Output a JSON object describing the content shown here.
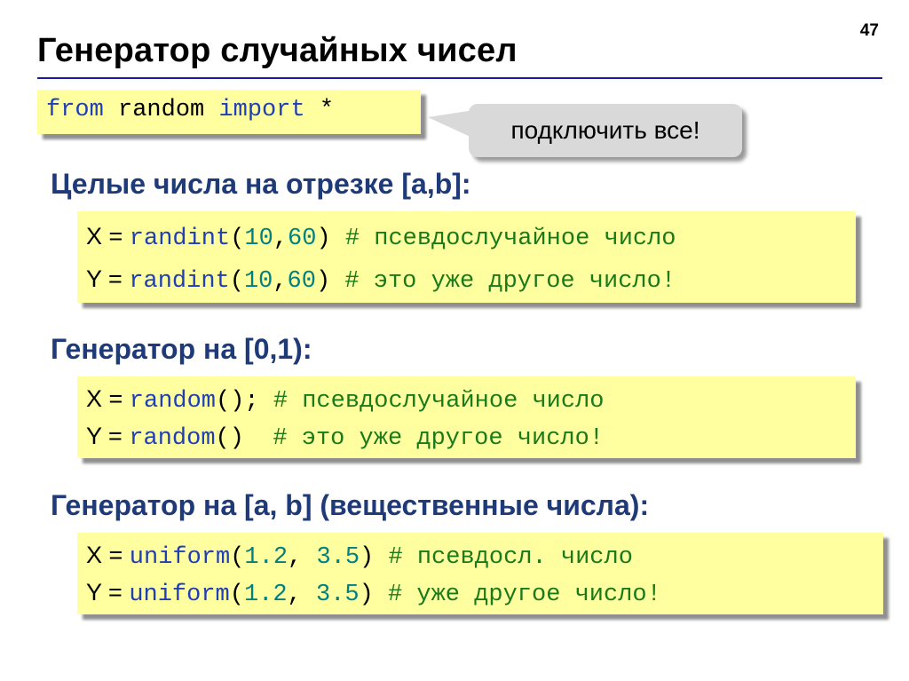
{
  "page_number": "47",
  "title": "Генератор случайных чисел",
  "import_block": {
    "kw_from": "from",
    "module": "random",
    "kw_import": "import",
    "star": "*"
  },
  "callout": "подключить все!",
  "section_int": {
    "heading": "Целые числа на отрезке [a,b]:",
    "lines": [
      {
        "var": "X",
        "eq": " = ",
        "fn": "randint",
        "open": "(",
        "a": "10",
        "sep": ",",
        "b": "60",
        "close": ")",
        "space": " ",
        "comment": "# псевдослучайное число"
      },
      {
        "var": "Y",
        "eq": " = ",
        "fn": "randint",
        "open": "(",
        "a": "10",
        "sep": ",",
        "b": "60",
        "close": ")",
        "space": " ",
        "comment": "# это уже другое число!"
      }
    ]
  },
  "section_01": {
    "heading": "Генератор на [0,1):",
    "lines": [
      {
        "var": "X",
        "eq": " = ",
        "fn": "random",
        "call": "();",
        "space": " ",
        "comment": "# псевдослучайное число"
      },
      {
        "var": "Y",
        "eq": " = ",
        "fn": "random",
        "call": "()",
        "space": "  ",
        "comment": "# это уже другое число!"
      }
    ]
  },
  "section_ab": {
    "heading": "Генератор на [a, b] (вещественные числа):",
    "lines": [
      {
        "var": "X",
        "eq": " = ",
        "fn": "uniform",
        "open": "(",
        "a": "1.2",
        "sep": ", ",
        "b": "3.5",
        "close": ")",
        "space": " ",
        "comment": "# псевдосл. число"
      },
      {
        "var": "Y",
        "eq": " = ",
        "fn": "uniform",
        "open": "(",
        "a": "1.2",
        "sep": ", ",
        "b": "3.5",
        "close": ")",
        "space": " ",
        "comment": "# уже другое число!"
      }
    ]
  },
  "colors": {
    "keyword": "#1f3fb5",
    "number": "#008080",
    "comment": "#1a7a1a",
    "heading": "#1f3a78",
    "code_background": "#ffffa0",
    "rule": "#1a1aa6"
  }
}
